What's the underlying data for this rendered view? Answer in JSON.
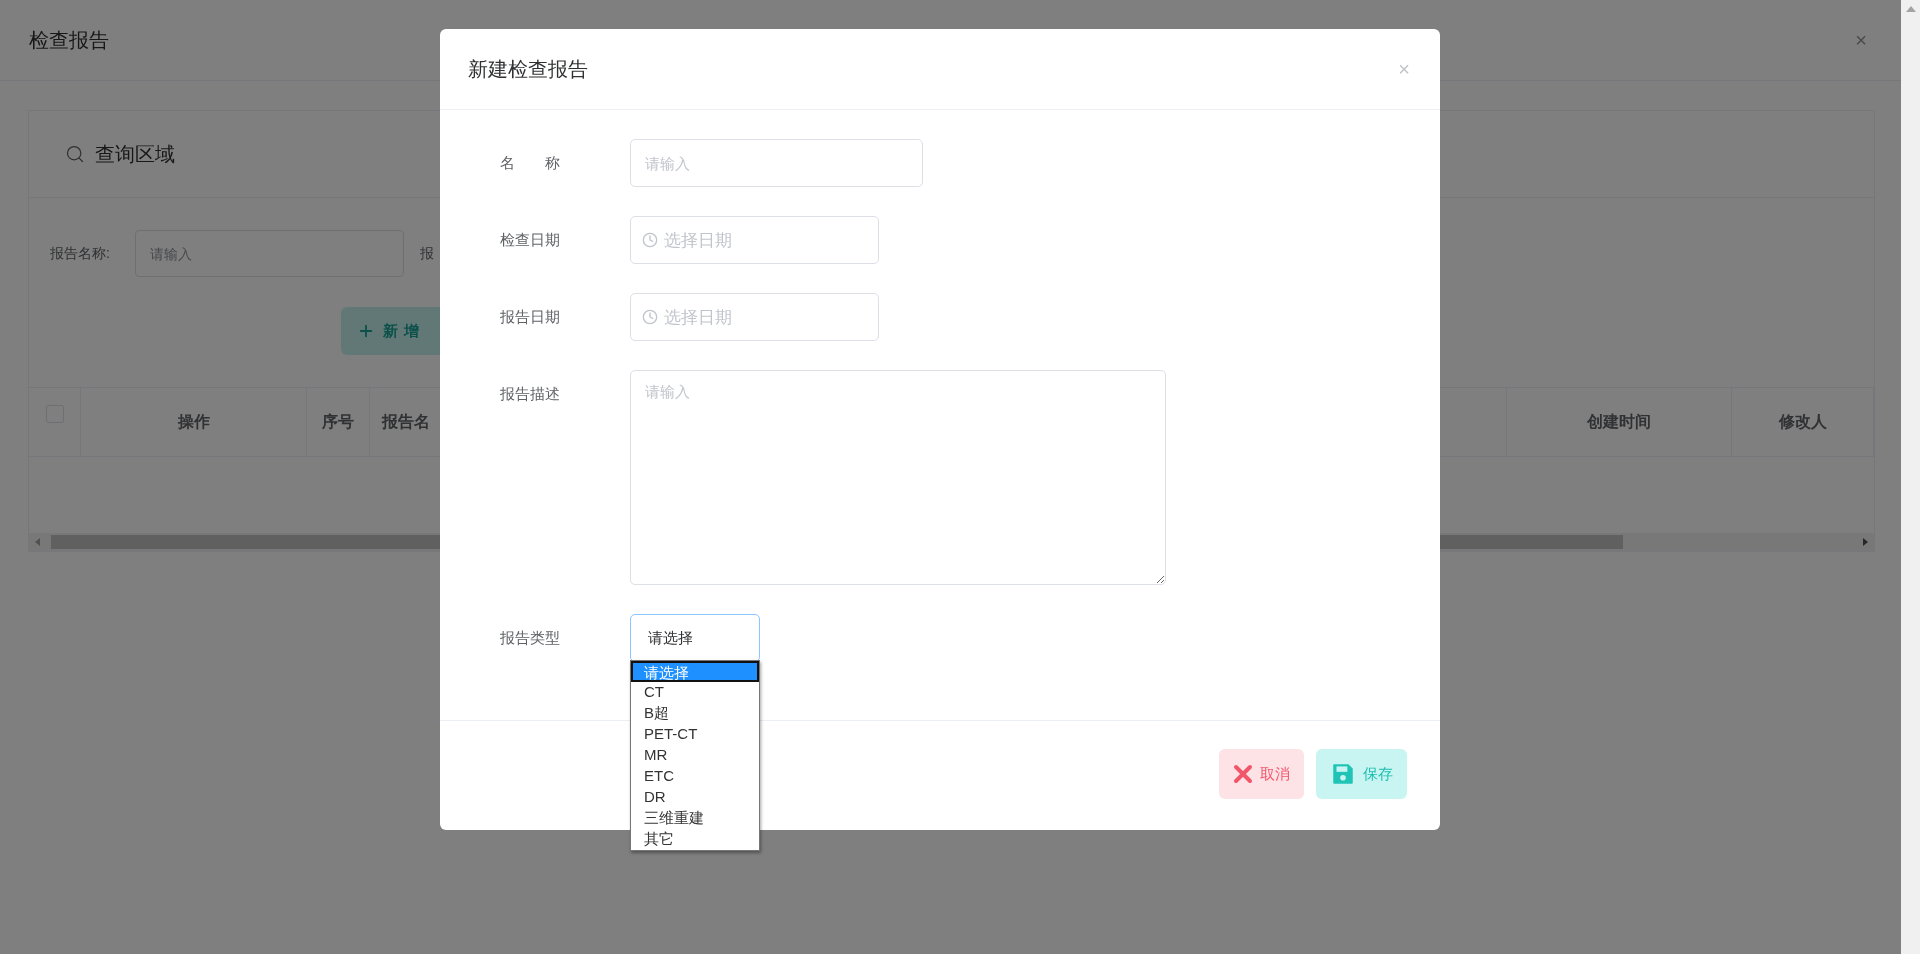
{
  "page": {
    "title": "检查报告",
    "close": "×"
  },
  "search_panel": {
    "title": "查询区域",
    "fields": [
      {
        "label": "报告名称:",
        "placeholder": "请输入"
      },
      {
        "label": "报"
      }
    ],
    "add_button": "新增"
  },
  "table": {
    "select_all": {
      "checked": false
    },
    "columns": [
      "操作",
      "序号",
      "报告名",
      "创建时间",
      "修改人"
    ]
  },
  "modal": {
    "title": "新建检查报告",
    "close": "×",
    "fields": [
      {
        "kind": "text",
        "label": "名　　称",
        "placeholder": "请输入"
      },
      {
        "kind": "date",
        "label": "检查日期",
        "placeholder": "选择日期"
      },
      {
        "kind": "date",
        "label": "报告日期",
        "placeholder": "选择日期"
      },
      {
        "kind": "textarea",
        "label": "报告描述",
        "placeholder": "请输入"
      },
      {
        "kind": "select",
        "label": "报告类型",
        "value": "请选择",
        "open": true,
        "options": [
          {
            "label": "请选择",
            "selected": true
          },
          {
            "label": "CT",
            "selected": false
          },
          {
            "label": "B超",
            "selected": false
          },
          {
            "label": "PET-CT",
            "selected": false
          },
          {
            "label": "MR",
            "selected": false
          },
          {
            "label": "ETC",
            "selected": false
          },
          {
            "label": "DR",
            "selected": false
          },
          {
            "label": "三维重建",
            "selected": false
          },
          {
            "label": "其它",
            "selected": false
          }
        ]
      }
    ]
  },
  "buttons": [
    {
      "kind": "cancel",
      "label": "取消"
    },
    {
      "kind": "save",
      "label": "保存"
    }
  ]
}
